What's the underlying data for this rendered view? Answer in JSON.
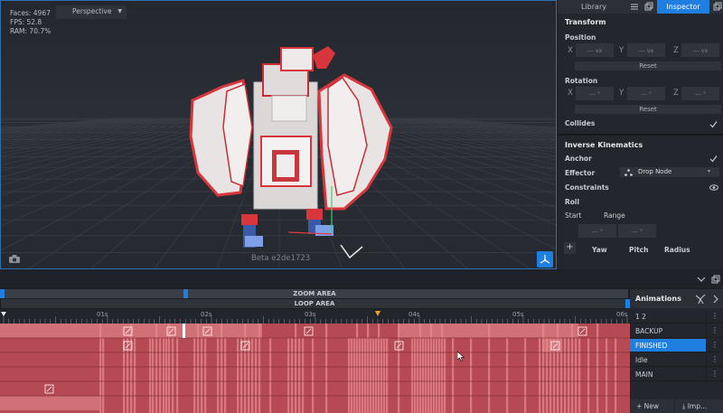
{
  "viewport": {
    "stats": {
      "faces": "Faces: 4967",
      "fps": "FPS: 52.8",
      "ram": "RAM: 70.7%"
    },
    "camera_mode": "Perspective",
    "version": "Beta e2de1723",
    "icons": {
      "camera": "camera-icon",
      "axis": "axis-gizmo-icon",
      "dropdown": "chevron-down-icon"
    }
  },
  "panel": {
    "tabs": {
      "library": "Library",
      "inspector": "Inspector"
    },
    "transform": {
      "title": "Transform",
      "position": {
        "label": "Position",
        "x": "X",
        "y": "Y",
        "z": "Z",
        "x_val": "--- vx",
        "y_val": "--- vx",
        "z_val": "--- vx",
        "reset": "Reset"
      },
      "rotation": {
        "label": "Rotation",
        "x": "X",
        "y": "Y",
        "z": "Z",
        "x_val": "--- °",
        "y_val": "--- °",
        "z_val": "--- °",
        "reset": "Reset"
      },
      "collides": "Collides"
    },
    "ik": {
      "title": "Inverse Kinematics",
      "anchor": "Anchor",
      "effector": "Effector",
      "effector_value": "Drop Node",
      "constraints": "Constraints",
      "roll": "Roll",
      "start": "Start",
      "range": "Range",
      "start_val": "--- °",
      "range_val": "--- °",
      "yaw": "Yaw",
      "pitch": "Pitch",
      "radius": "Radius",
      "add": "+"
    }
  },
  "timeline": {
    "zoom_area": "ZOOM AREA",
    "loop_area": "LOOP AREA",
    "ticks": [
      {
        "label": "01s",
        "t": 1
      },
      {
        "label": "02s",
        "t": 2
      },
      {
        "label": "03s",
        "t": 3
      },
      {
        "label": "04s",
        "t": 4
      },
      {
        "label": "05s",
        "t": 5
      },
      {
        "label": "06s",
        "t": 6
      }
    ],
    "duration_s": 6,
    "playhead_s": 3.6,
    "animations": {
      "title": "Animations",
      "items": [
        {
          "label": "1 2",
          "selected": false
        },
        {
          "label": "BACKUP",
          "selected": false
        },
        {
          "label": "FINISHED",
          "selected": true
        },
        {
          "label": "Idle",
          "selected": false
        },
        {
          "label": "MAIN",
          "selected": false
        }
      ],
      "new_label": "New",
      "import_label": "Imp...",
      "more": "⋮"
    }
  },
  "colors": {
    "accent": "#1e7fe0",
    "track": "#b54a52",
    "track_light": "#e58a8f",
    "selection": "#1e7fe0"
  }
}
